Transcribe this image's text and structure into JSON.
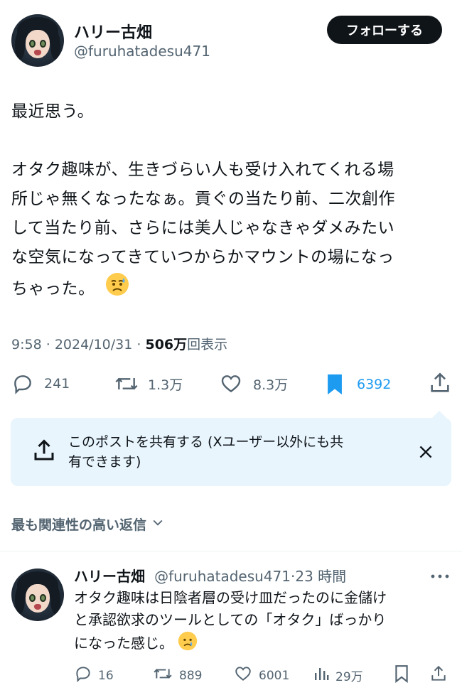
{
  "author": {
    "name": "ハリー古畑",
    "handle": "@furuhatadesu471"
  },
  "follow_button": "フォローする",
  "post": {
    "text": "最近思う。\n\nオタク趣味が、生きづらい人も受け入れてくれる場\n所じゃ無くなったなぁ。貢ぐの当たり前、二次創作\nして当たり前、さらには美人じゃなきゃダメみたい\nな空気になってきていつからかマウントの場になっ\nちゃった。",
    "emoji_name": "sad-but-relieved-face-icon",
    "time": "9:58",
    "sep1": "·",
    "date": "2024/10/31",
    "sep2": "·",
    "views_count": "506万",
    "views_label": "回表示"
  },
  "actions": {
    "replies": "241",
    "reposts": "1.3万",
    "likes": "8.3万",
    "bookmarks": "6392"
  },
  "colors": {
    "accent": "#1d9bf0",
    "text": "#0f1419",
    "muted": "#536471",
    "share_bg": "#e8f5fd"
  },
  "share_prompt": "このポストを共有する (Xユーザー以外にも共\n有できます)",
  "sort_label": "最も関連性の高い返信",
  "reply": {
    "name": "ハリー古畑",
    "handle": "@furuhatadesu471",
    "sep": "·",
    "time_ago": "23 時間",
    "text": "オタク趣味は日陰者層の受け皿だったのに金儲け\nと承認欲求のツールとしての「オタク」ばっかり\nになった感じ。",
    "emoji_name": "crying-face-icon",
    "replies": "16",
    "reposts": "889",
    "likes": "6001",
    "views": "29万"
  }
}
